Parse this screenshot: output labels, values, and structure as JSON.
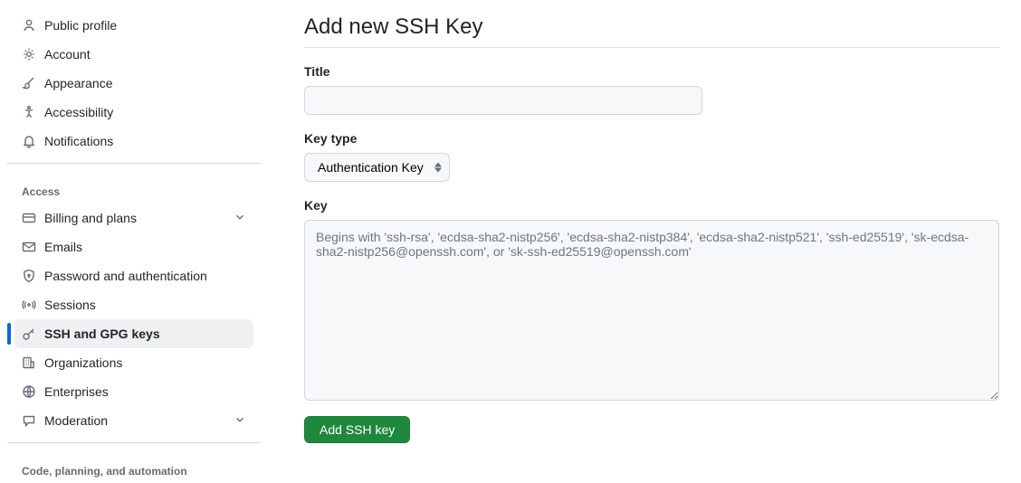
{
  "sidebar": {
    "items_top": [
      {
        "label": "Public profile",
        "icon": "person"
      },
      {
        "label": "Account",
        "icon": "gear"
      },
      {
        "label": "Appearance",
        "icon": "brush"
      },
      {
        "label": "Accessibility",
        "icon": "accessibility"
      },
      {
        "label": "Notifications",
        "icon": "bell"
      }
    ],
    "section_access": "Access",
    "items_access": [
      {
        "label": "Billing and plans",
        "icon": "card",
        "chevron": true
      },
      {
        "label": "Emails",
        "icon": "mail"
      },
      {
        "label": "Password and authentication",
        "icon": "shield"
      },
      {
        "label": "Sessions",
        "icon": "broadcast"
      },
      {
        "label": "SSH and GPG keys",
        "icon": "key",
        "active": true
      },
      {
        "label": "Organizations",
        "icon": "org"
      },
      {
        "label": "Enterprises",
        "icon": "globe"
      },
      {
        "label": "Moderation",
        "icon": "comment",
        "chevron": true
      }
    ],
    "section_code": "Code, planning, and automation"
  },
  "main": {
    "heading": "Add new SSH Key",
    "title_label": "Title",
    "title_value": "",
    "keytype_label": "Key type",
    "keytype_selected": "Authentication Key",
    "key_label": "Key",
    "key_placeholder": "Begins with 'ssh-rsa', 'ecdsa-sha2-nistp256', 'ecdsa-sha2-nistp384', 'ecdsa-sha2-nistp521', 'ssh-ed25519', 'sk-ecdsa-sha2-nistp256@openssh.com', or 'sk-ssh-ed25519@openssh.com'",
    "submit_label": "Add SSH key"
  }
}
